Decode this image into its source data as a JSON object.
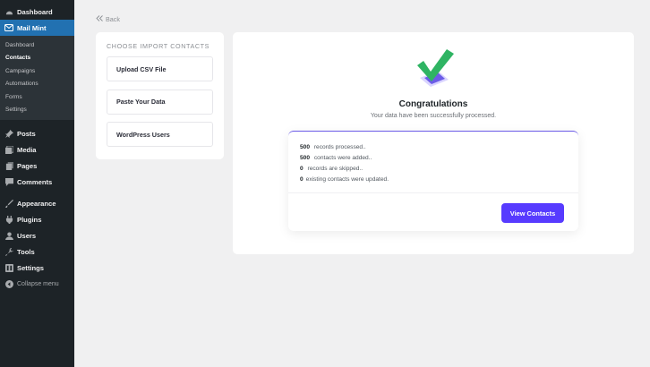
{
  "sidebar": {
    "top_items": [
      {
        "label": "Dashboard",
        "icon": "dashboard-icon"
      },
      {
        "label": "Mail Mint",
        "icon": "mail-icon"
      }
    ],
    "submenu": [
      "Dashboard",
      "Contacts",
      "Campaigns",
      "Automations",
      "Forms",
      "Settings"
    ],
    "items": [
      {
        "label": "Posts",
        "icon": "pin-icon"
      },
      {
        "label": "Media",
        "icon": "media-icon"
      },
      {
        "label": "Pages",
        "icon": "pages-icon"
      },
      {
        "label": "Comments",
        "icon": "comment-icon"
      }
    ],
    "items2": [
      {
        "label": "Appearance",
        "icon": "brush-icon"
      },
      {
        "label": "Plugins",
        "icon": "plugin-icon"
      },
      {
        "label": "Users",
        "icon": "user-icon"
      },
      {
        "label": "Tools",
        "icon": "wrench-icon"
      },
      {
        "label": "Settings",
        "icon": "settings-icon"
      }
    ],
    "collapse_label": "Collapse menu"
  },
  "back_label": "Back",
  "import_panel": {
    "title": "CHOOSE IMPORT CONTACTS",
    "options": [
      "Upload CSV File",
      "Paste Your Data",
      "WordPress Users"
    ]
  },
  "success": {
    "title": "Congratulations",
    "message": "Your data have been successfully processed.",
    "stats": [
      {
        "count": "500",
        "text": "records processed.."
      },
      {
        "count": "500",
        "text": "contacts were added.."
      },
      {
        "count": "0",
        "text": "records are skipped.."
      },
      {
        "count": "0",
        "text": "existing contacts were updated."
      }
    ],
    "button_label": "View Contacts"
  },
  "colors": {
    "sidebar_bg": "#1d2327",
    "active_menu": "#2271b1",
    "accent": "#573bff",
    "check": "#2fb463"
  }
}
